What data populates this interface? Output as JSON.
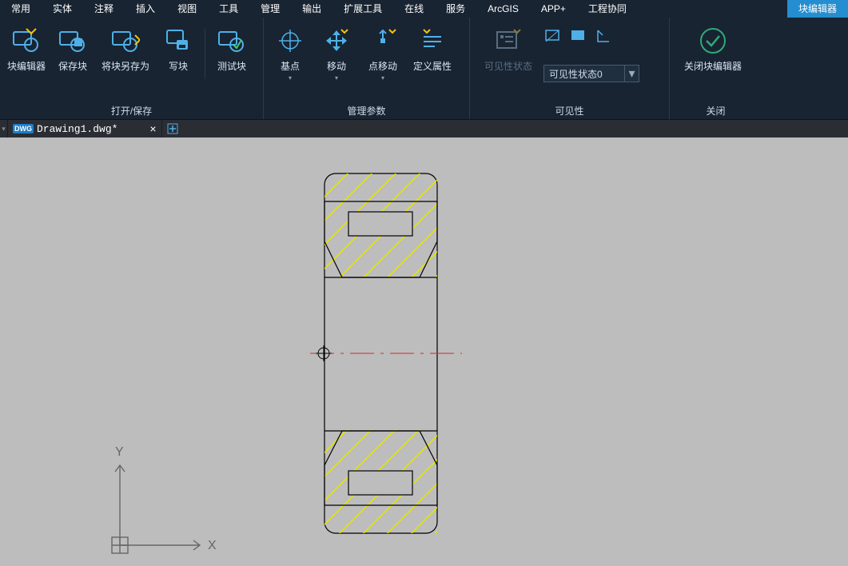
{
  "tabs": {
    "common": "常用",
    "entity": "实体",
    "annotate": "注释",
    "insert": "插入",
    "view": "视图",
    "tools": "工具",
    "manage": "管理",
    "output": "输出",
    "ext_tools": "扩展工具",
    "online": "在线",
    "service": "服务",
    "arcgis": "ArcGIS",
    "app_plus": "APP+",
    "eng_collab": "工程协同",
    "block_editor": "块编辑器"
  },
  "ribbon": {
    "open_save": {
      "title": "打开/保存",
      "block_editor": "块编辑器",
      "save_block": "保存块",
      "save_block_as": "将块另存为",
      "write_block": "写块",
      "test_block": "测试块"
    },
    "manage_params": {
      "title": "管理参数",
      "base_point": "基点",
      "move": "移动",
      "point_move": "点移动",
      "define_attr": "定义属性"
    },
    "visibility": {
      "title": "可见性",
      "visibility_state": "可见性状态",
      "combo_value": "可见性状态0"
    },
    "close": {
      "title": "关闭",
      "close_block_editor": "关闭块编辑器"
    }
  },
  "doc": {
    "filename": "Drawing1.dwg*"
  },
  "ucs": {
    "x": "X",
    "y": "Y"
  }
}
